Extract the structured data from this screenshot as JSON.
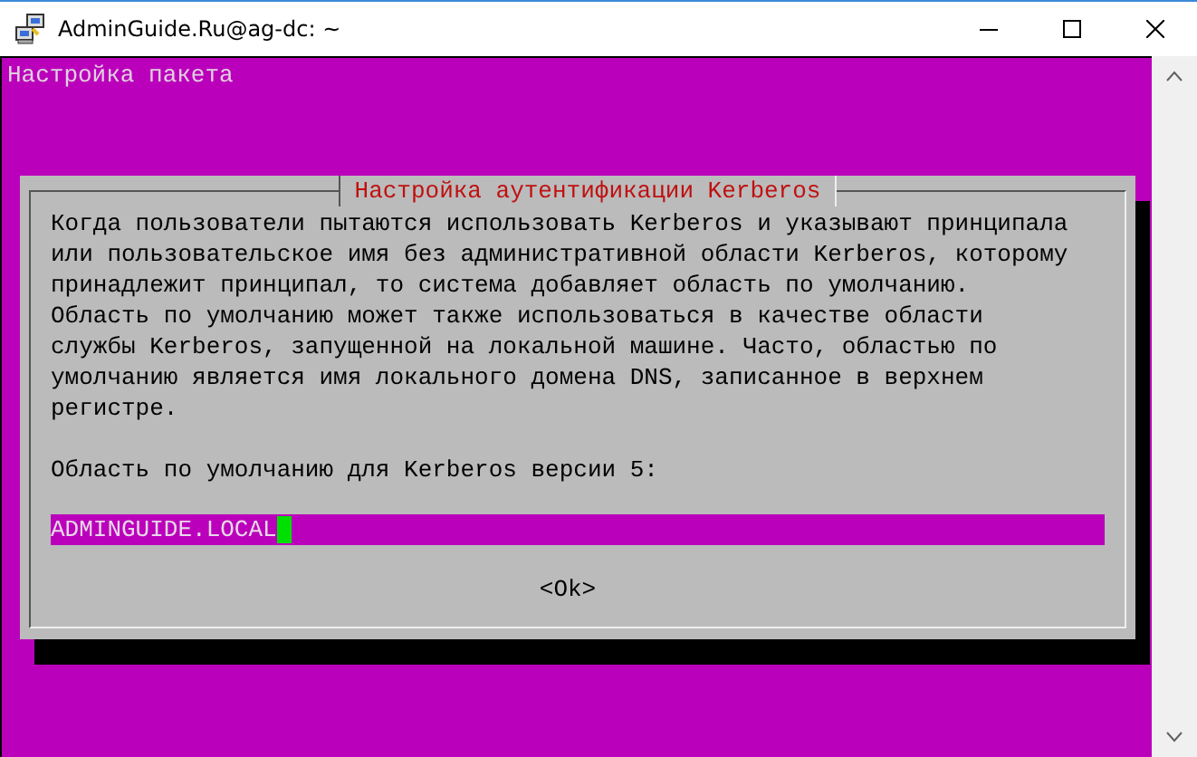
{
  "window": {
    "title": "AdminGuide.Ru@ag-dc: ~"
  },
  "console": {
    "header": "Настройка пакета"
  },
  "dialog": {
    "title": "Настройка аутентификации Kerberos",
    "description": "Когда пользователи пытаются использовать Kerberos и указывают принципала\nили пользовательское имя без административной области Kerberos, которому\nпринадлежит принципал, то система добавляет область по умолчанию.\nОбласть по умолчанию может также использоваться в качестве области\nслужбы Kerberos, запущенной на локальной машине. Часто, областью по\nумолчанию является имя локального домена DNS, записанное в верхнем\nрегистре.",
    "prompt": "Область по умолчанию для Kerberos версии 5:",
    "input": {
      "value": "ADMINGUIDE.LOCAL"
    },
    "buttons": [
      {
        "label": "<Ok>"
      }
    ]
  }
}
